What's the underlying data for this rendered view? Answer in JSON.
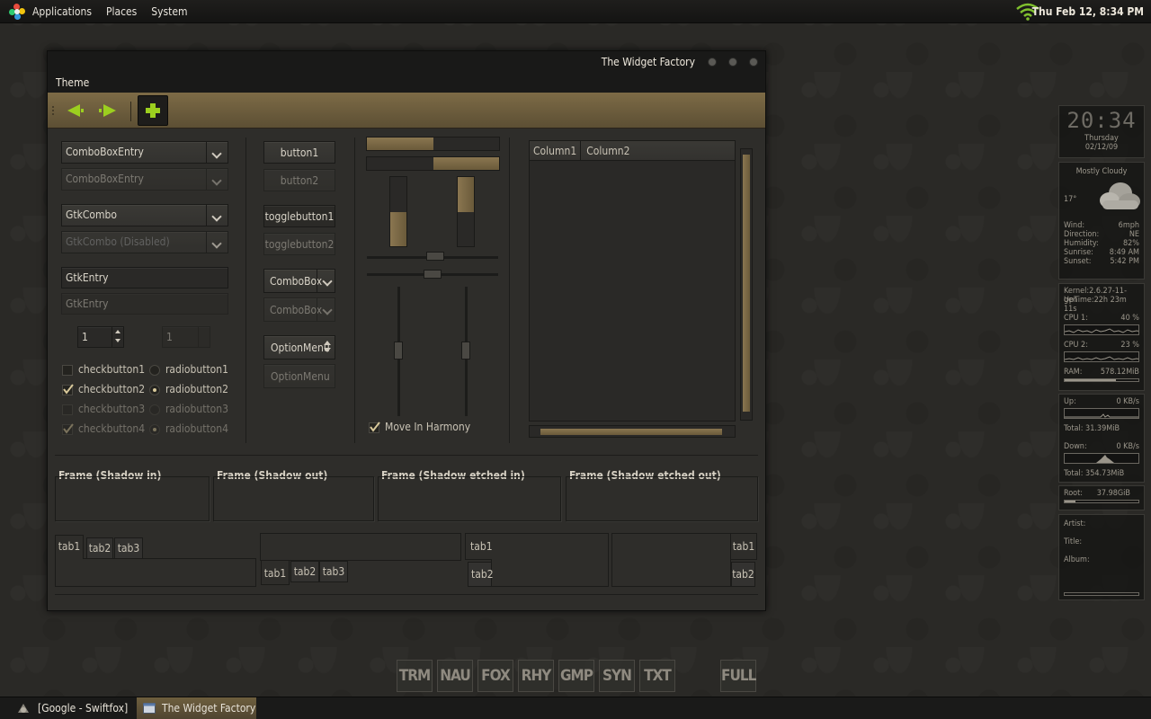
{
  "top_panel": {
    "menus": [
      "Applications",
      "Places",
      "System"
    ],
    "datetime": "Thu Feb 12,  8:34 PM"
  },
  "window": {
    "title": "The Widget Factory",
    "menu": "Theme"
  },
  "left_col": {
    "combo_entry": "ComboBoxEntry",
    "combo_entry_disabled": "ComboBoxEntry",
    "gtk_combo": "GtkCombo",
    "gtk_combo_disabled": "GtkCombo (Disabled)",
    "entry": "GtkEntry",
    "entry_disabled": "GtkEntry",
    "spin1": "1",
    "spin2": "1",
    "checks": [
      "checkbutton1",
      "checkbutton2",
      "checkbutton3",
      "checkbutton4"
    ],
    "radios": [
      "radiobutton1",
      "radiobutton2",
      "radiobutton3",
      "radiobutton4"
    ]
  },
  "mid_col": {
    "button1": "button1",
    "button2": "button2",
    "toggle1": "togglebutton1",
    "toggle2": "togglebutton2",
    "combobox": "ComboBox",
    "combobox_disabled": "ComboBox",
    "optionmenu": "OptionMenu",
    "optionmenu_disabled": "OptionMenu"
  },
  "sliders": {
    "harmony_label": "Move In Harmony",
    "hprogress1": 0.5,
    "hprogress2": 0.5,
    "vprogress1": 0.5,
    "vprogress2": 0.5
  },
  "tree": {
    "columns": [
      "Column1",
      "Column2"
    ]
  },
  "frames": [
    "Frame (Shadow in)",
    "Frame (Shadow out)",
    "Frame (Shadow etched in)",
    "Frame (Shadow etched out)"
  ],
  "notebooks": {
    "top": [
      "tab1",
      "tab2",
      "tab3"
    ],
    "bottom": [
      "tab1",
      "tab2",
      "tab3"
    ],
    "left": [
      "tab1",
      "tab2"
    ],
    "right": [
      "tab1",
      "tab2"
    ]
  },
  "right_panel": {
    "clock": "20:34",
    "day": "Thursday",
    "date": "02/12/09",
    "weather": "Mostly Cloudy",
    "temp": "17°",
    "wind_label": "Wind:",
    "wind": "6mph",
    "direction_label": "Direction:",
    "direction": "NE",
    "humidity_label": "Humidity:",
    "humidity": "82%",
    "sunrise_label": "Sunrise:",
    "sunrise": "8:49 AM",
    "sunset_label": "Sunset:",
    "sunset": "5:42 PM",
    "kernel": "Kernel:2.6.27-11-gen",
    "uptime": "UpTime:22h 23m 11s",
    "cpu1_label": "CPU 1:",
    "cpu1": "40 %",
    "cpu2_label": "CPU 2:",
    "cpu2": "23 %",
    "ram_label": "RAM:",
    "ram": "578.12MiB",
    "up_label": "Up:",
    "up": "0   KB/s",
    "up_total": "Total: 31.39MiB",
    "down_label": "Down:",
    "down": "0   KB/s",
    "down_total": "Total: 354.73MiB",
    "root_label": "Root:",
    "root": "37.98GiB",
    "artist_label": "Artist:",
    "title_label": "Title:",
    "album_label": "Album:"
  },
  "dock": [
    "TRM",
    "NAU",
    "FOX",
    "RHY",
    "GMP",
    "SYN",
    "TXT",
    "FULL"
  ],
  "taskbar": {
    "items": [
      "[Google - Swiftfox]",
      "The Widget Factory"
    ]
  }
}
